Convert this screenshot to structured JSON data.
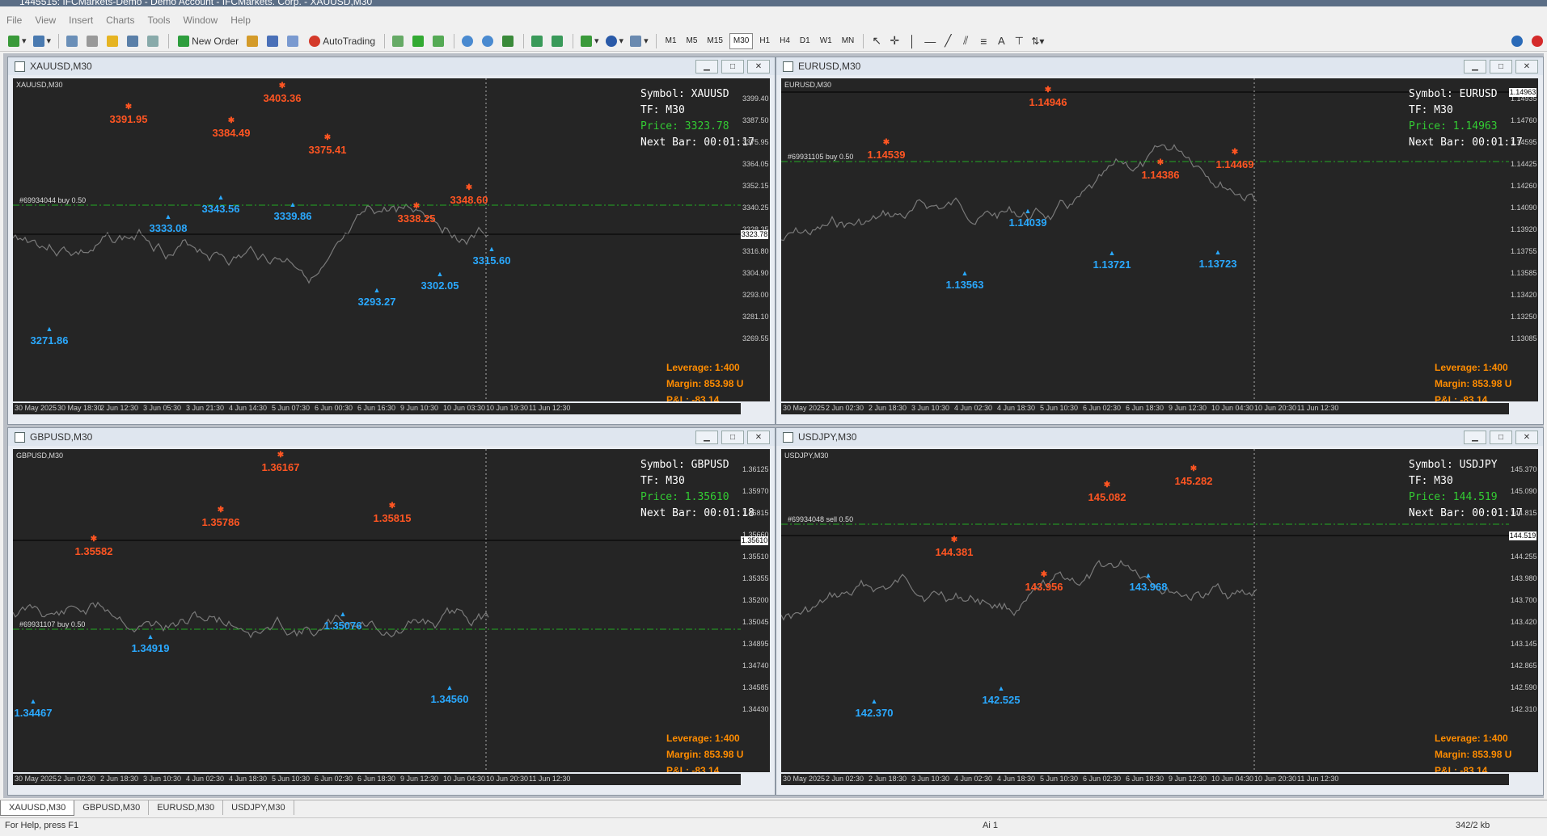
{
  "window_title": "1445515: IFCMarkets-Demo - Demo Account - IFCMarkets. Corp. - XAUUSD,M30",
  "menu": [
    "File",
    "View",
    "Insert",
    "Charts",
    "Tools",
    "Window",
    "Help"
  ],
  "toolbar": {
    "new_order": "New Order",
    "autotrading": "AutoTrading",
    "timeframes": [
      "M1",
      "M5",
      "M15",
      "M30",
      "H1",
      "H4",
      "D1",
      "W1",
      "MN"
    ],
    "active_timeframe": "M30",
    "tools_text": "A"
  },
  "charts": [
    {
      "window_title": "XAUUSD,M30",
      "inner_title": "XAUUSD,M30",
      "symbol": "Symbol: XAUUSD",
      "tf": "TF: M30",
      "price": "Price: 3323.78",
      "next_bar": "Next Bar: 00:01:17",
      "leverage": "Leverage: 1:400",
      "margin": "Margin: 853.98 U",
      "pnl": "P&L: -83.14",
      "order": "#69934044 buy 0.50",
      "current_price": "3323.78",
      "y_ticks": [
        "3399.40",
        "3387.50",
        "3375.95",
        "3364.05",
        "3352.15",
        "3340.25",
        "3328.35",
        "3316.80",
        "3304.90",
        "3293.00",
        "3281.10",
        "3269.55"
      ],
      "x_ticks": [
        "30 May 2025",
        "30 May 18:30",
        "2 Jun 12:30",
        "3 Jun 05:30",
        "3 Jun 21:30",
        "4 Jun 14:30",
        "5 Jun 07:30",
        "6 Jun 00:30",
        "6 Jun 16:30",
        "9 Jun 10:30",
        "10 Jun 03:30",
        "10 Jun 19:30",
        "11 Jun 12:30"
      ],
      "highs": [
        {
          "text": "3391.95",
          "x": 143,
          "y": 50
        },
        {
          "text": "3403.36",
          "x": 333,
          "y": 24
        },
        {
          "text": "3384.49",
          "x": 270,
          "y": 67
        },
        {
          "text": "3375.41",
          "x": 389,
          "y": 88
        },
        {
          "text": "3338.25",
          "x": 499,
          "y": 173
        },
        {
          "text": "3348.60",
          "x": 564,
          "y": 150
        }
      ],
      "lows": [
        {
          "text": "3333.08",
          "x": 192,
          "y": 185
        },
        {
          "text": "3343.56",
          "x": 257,
          "y": 161
        },
        {
          "text": "3339.86",
          "x": 346,
          "y": 170
        },
        {
          "text": "3293.27",
          "x": 450,
          "y": 276
        },
        {
          "text": "3302.05",
          "x": 528,
          "y": 256
        },
        {
          "text": "3315.60",
          "x": 592,
          "y": 225
        },
        {
          "text": "3271.86",
          "x": 45,
          "y": 324
        }
      ]
    },
    {
      "window_title": "EURUSD,M30",
      "inner_title": "EURUSD,M30",
      "symbol": "Symbol: EURUSD",
      "tf": "TF: M30",
      "price": "Price: 1.14963",
      "next_bar": "Next Bar: 00:01:17",
      "leverage": "Leverage: 1:400",
      "margin": "Margin: 853.98 U",
      "pnl": "P&L: -83.14",
      "order": "#69931105 buy 0.50",
      "current_price": "1.14963",
      "y_ticks": [
        "1.14935",
        "1.14760",
        "1.14595",
        "1.14425",
        "1.14260",
        "1.14090",
        "1.13920",
        "1.13755",
        "1.13585",
        "1.13420",
        "1.13250",
        "1.13085"
      ],
      "x_ticks": [
        "30 May 2025",
        "2 Jun 02:30",
        "2 Jun 18:30",
        "3 Jun 10:30",
        "4 Jun 02:30",
        "4 Jun 18:30",
        "5 Jun 10:30",
        "6 Jun 02:30",
        "6 Jun 18:30",
        "9 Jun 12:30",
        "10 Jun 04:30",
        "10 Jun 20:30",
        "11 Jun 12:30"
      ],
      "highs": [
        {
          "text": "1.14946",
          "x": 330,
          "y": 29
        },
        {
          "text": "1.14539",
          "x": 130,
          "y": 94
        },
        {
          "text": "1.14386",
          "x": 469,
          "y": 119
        },
        {
          "text": "1.14469",
          "x": 561,
          "y": 106
        }
      ],
      "lows": [
        {
          "text": "1.14039",
          "x": 305,
          "y": 178
        },
        {
          "text": "1.13563",
          "x": 227,
          "y": 255
        },
        {
          "text": "1.13721",
          "x": 409,
          "y": 230
        },
        {
          "text": "1.13723",
          "x": 540,
          "y": 229
        }
      ]
    },
    {
      "window_title": "GBPUSD,M30",
      "inner_title": "GBPUSD,M30",
      "symbol": "Symbol: GBPUSD",
      "tf": "TF: M30",
      "price": "Price: 1.35610",
      "next_bar": "Next Bar: 00:01:18",
      "leverage": "Leverage: 1:400",
      "margin": "Margin: 853.98 U",
      "pnl": "P&L: -83.14",
      "order": "#69931107 buy 0.50",
      "current_price": "1.35610",
      "y_ticks": [
        "1.36125",
        "1.35970",
        "1.35815",
        "1.35660",
        "1.35510",
        "1.35355",
        "1.35200",
        "1.35045",
        "1.34895",
        "1.34740",
        "1.34585",
        "1.34430"
      ],
      "x_ticks": [
        "30 May 2025",
        "2 Jun 02:30",
        "2 Jun 18:30",
        "3 Jun 10:30",
        "4 Jun 02:30",
        "4 Jun 18:30",
        "5 Jun 10:30",
        "6 Jun 02:30",
        "6 Jun 18:30",
        "9 Jun 12:30",
        "10 Jun 04:30",
        "10 Jun 20:30",
        "11 Jun 12:30"
      ],
      "highs": [
        {
          "text": "1.36167",
          "x": 331,
          "y": 22
        },
        {
          "text": "1.35582",
          "x": 100,
          "y": 126
        },
        {
          "text": "1.35786",
          "x": 257,
          "y": 90
        },
        {
          "text": "1.35815",
          "x": 469,
          "y": 85
        }
      ],
      "lows": [
        {
          "text": "1.34919",
          "x": 170,
          "y": 246
        },
        {
          "text": "1.35076",
          "x": 408,
          "y": 218
        },
        {
          "text": "1.34560",
          "x": 540,
          "y": 309
        },
        {
          "text": "1.34467",
          "x": 25,
          "y": 326
        }
      ]
    },
    {
      "window_title": "USDJPY,M30",
      "inner_title": "USDJPY,M30",
      "symbol": "Symbol: USDJPY",
      "tf": "TF: M30",
      "price": "Price: 144.519",
      "next_bar": "Next Bar: 00:01:17",
      "leverage": "Leverage: 1:400",
      "margin": "Margin: 853.98 U",
      "pnl": "P&L: -83.14",
      "order": "#69934048 sell 0.50",
      "current_price": "144.519",
      "y_ticks": [
        "145.370",
        "145.090",
        "144.815",
        "144.535",
        "144.255",
        "143.980",
        "143.700",
        "143.420",
        "143.145",
        "142.865",
        "142.590",
        "142.310"
      ],
      "x_ticks": [
        "30 May 2025",
        "2 Jun 02:30",
        "2 Jun 18:30",
        "3 Jun 10:30",
        "4 Jun 02:30",
        "4 Jun 18:30",
        "5 Jun 10:30",
        "6 Jun 02:30",
        "6 Jun 18:30",
        "9 Jun 12:30",
        "10 Jun 04:30",
        "10 Jun 20:30",
        "11 Jun 12:30"
      ],
      "highs": [
        {
          "text": "145.282",
          "x": 510,
          "y": 39
        },
        {
          "text": "145.082",
          "x": 403,
          "y": 59
        },
        {
          "text": "144.381",
          "x": 214,
          "y": 127
        },
        {
          "text": "143.956",
          "x": 325,
          "y": 170
        }
      ],
      "lows": [
        {
          "text": "143.968",
          "x": 454,
          "y": 170
        },
        {
          "text": "142.525",
          "x": 272,
          "y": 310
        },
        {
          "text": "142.370",
          "x": 115,
          "y": 326
        }
      ]
    }
  ],
  "tabs": [
    "XAUUSD,M30",
    "GBPUSD,M30",
    "EURUSD,M30",
    "USDJPY,M30"
  ],
  "active_tab": "XAUUSD,M30",
  "status": {
    "help": "For Help, press F1",
    "profile": "Ai 1",
    "traffic": "342/2 kb"
  }
}
